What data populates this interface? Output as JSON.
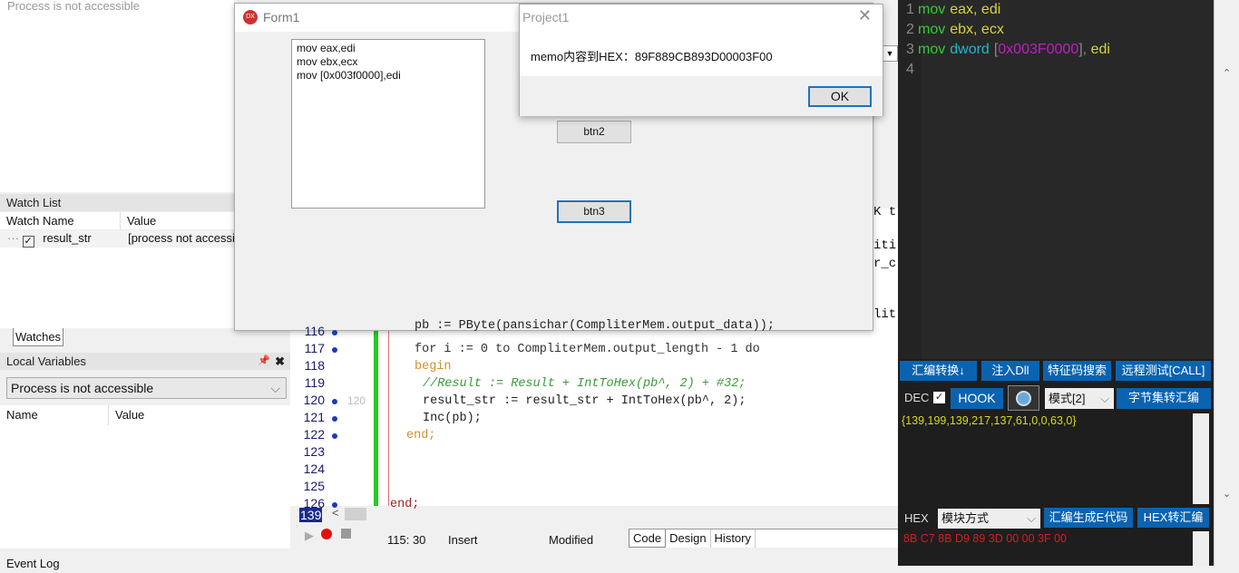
{
  "left": {
    "top_status": "Process is not accessible",
    "watch_list": {
      "title": "Watch List",
      "columns": [
        "Watch Name",
        "Value"
      ],
      "rows": [
        {
          "name": "result_str",
          "value": "[process not accessi",
          "checked": true
        }
      ]
    },
    "tab": "Watches",
    "local_vars": {
      "title": "Local Variables",
      "combo": "Process is not accessible",
      "columns": [
        "Name",
        "Value"
      ]
    },
    "event_log": "Event Log"
  },
  "editor": {
    "lines": [
      {
        "n": "116",
        "code": "pb := PByte(pansichar(CompliterMem.output_data));",
        "dot": true
      },
      {
        "n": "117",
        "code": "for i := 0 to CompliterMem.output_length - 1 do",
        "dot": true
      },
      {
        "n": "118",
        "code": "begin",
        "dot": false
      },
      {
        "n": "119",
        "code": "//Result := Result + IntToHex(pb^, 2) + #32;",
        "dot": false
      },
      {
        "n": "120",
        "code": "result_str := result_str + IntToHex(pb^, 2);",
        "dot": true,
        "mark": "120"
      },
      {
        "n": "121",
        "code": "Inc(pb);",
        "dot": true
      },
      {
        "n": "122",
        "code": "end;",
        "dot": true
      },
      {
        "n": "123",
        "code": "",
        "dot": false
      },
      {
        "n": "124",
        "code": "",
        "dot": false
      },
      {
        "n": "125",
        "code": "",
        "dot": false
      },
      {
        "n": "126",
        "code": "end;",
        "dot": true
      }
    ],
    "current_line": "139",
    "hidden_fragments": [
      "K t",
      "iti",
      "r_c",
      "lit"
    ],
    "status": {
      "position": "115: 30",
      "mode": "Insert",
      "modified": "Modified",
      "tabs": [
        "Code",
        "Design",
        "History"
      ]
    }
  },
  "form1": {
    "title": "Form1",
    "memo_lines": [
      "mov eax,edi",
      "mov ebx,ecx",
      "mov [0x003f0000],edi"
    ],
    "btn2": "btn2",
    "btn3": "btn3"
  },
  "dialog": {
    "title": "Project1",
    "message": "memo内容到HEX：89F889CB893D00003F00",
    "ok": "OK"
  },
  "asm_tool": {
    "asm_lines": [
      {
        "n": "1",
        "op": "mov",
        "rest": "eax, edi"
      },
      {
        "n": "2",
        "op": "mov",
        "rest": "ebx, ecx"
      },
      {
        "n": "3",
        "op": "mov",
        "kw": "dword",
        "br1": "[",
        "addr": "0x003F0000",
        "br2": "],",
        "rest": " edi"
      },
      {
        "n": "4"
      }
    ],
    "buttons_row1": [
      "汇编转换↓",
      "注入Dll",
      "特征码搜索",
      "远程测试[CALL]"
    ],
    "dec_label": "DEC",
    "dec_checked": true,
    "hook": "HOOK",
    "mode_select": "模式[2]",
    "byteset_btn": "字节集转汇编",
    "dec_output": "{139,199,139,217,137,61,0,0,63,0}",
    "hex_label": "HEX",
    "module_select": "模块方式",
    "gen_e_btn": "汇编生成E代码",
    "hex_to_asm_btn": "HEX转汇编",
    "hex_output": "8B C7 8B D9 89 3D 00 00 3F 00",
    "colors": {
      "bg": "#282828",
      "button": "#0b63b0",
      "dec_text": "#d8d820",
      "hex_text": "#d02020",
      "op": "#33cc33",
      "operand": "#d4d43a",
      "keyword": "#22b8c8",
      "address": "#c020c0"
    }
  }
}
